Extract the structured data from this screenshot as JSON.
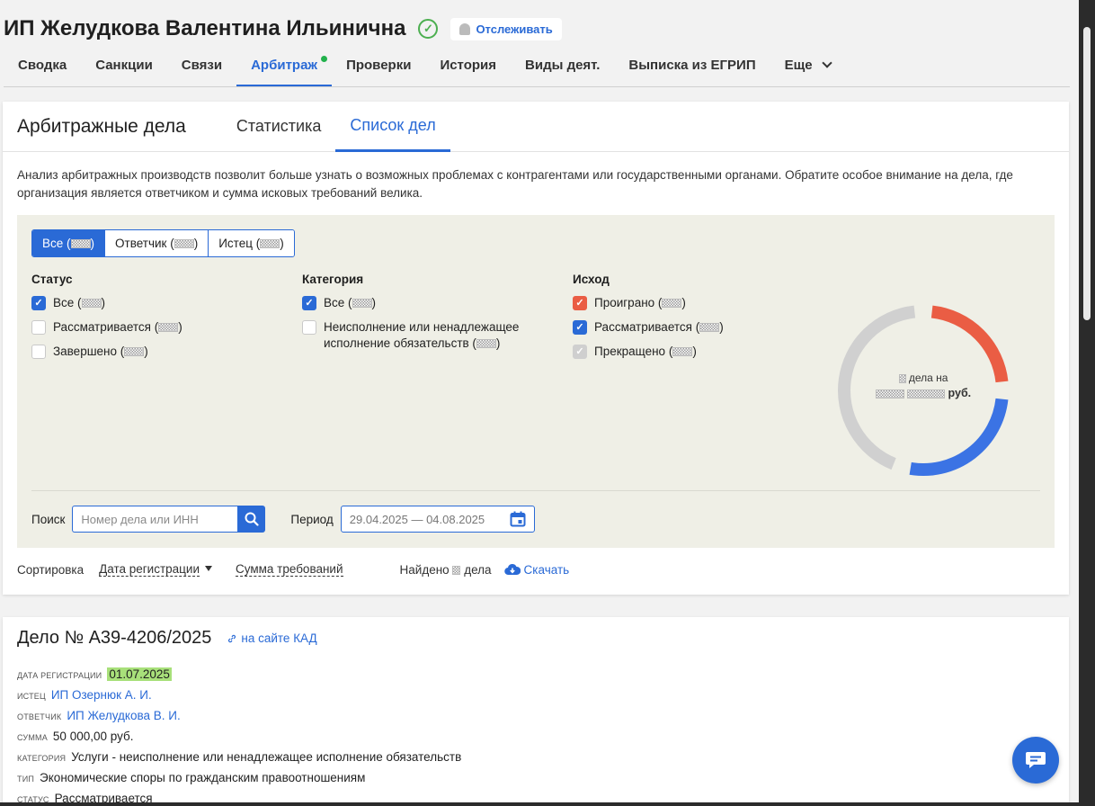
{
  "header": {
    "company_name": "ИП Желудкова Валентина Ильинична",
    "follow_label": "Отслеживать"
  },
  "nav": [
    {
      "label": "Сводка"
    },
    {
      "label": "Санкции"
    },
    {
      "label": "Связи"
    },
    {
      "label": "Арбитраж",
      "active": true
    },
    {
      "label": "Проверки"
    },
    {
      "label": "История"
    },
    {
      "label": "Виды деят."
    },
    {
      "label": "Выписка из ЕГРИП"
    },
    {
      "label": "Еще"
    }
  ],
  "arbitration": {
    "title": "Арбитражные дела",
    "tabs": [
      "Статистика",
      "Список дел"
    ],
    "active_tab": "Список дел",
    "description": "Анализ арбитражных производств позволит больше узнать о возможных проблемах с контрагентами или государственными органами. Обратите особое внимание на дела, где организация является ответчиком и сумма исковых требований велика.",
    "role_filter": {
      "all": "Все",
      "defendant": "Ответчик",
      "plaintiff": "Истец"
    },
    "status": {
      "title": "Статус",
      "items": [
        "Все",
        "Рассматривается",
        "Завершено"
      ]
    },
    "category": {
      "title": "Категория",
      "items": [
        "Все",
        "Неисполнение или ненадлежащее исполнение обязательств"
      ]
    },
    "outcome": {
      "title": "Исход",
      "items": [
        "Проиграно",
        "Рассматривается",
        "Прекращено"
      ]
    },
    "donut": {
      "line1": "дела на",
      "line2": "руб.",
      "segments": [
        {
          "name": "Проиграно",
          "color": "#ea5d44",
          "fraction": 0.23
        },
        {
          "name": "Рассматривается",
          "color": "#3b73e4",
          "fraction": 0.27
        },
        {
          "name": "Прекращено",
          "color": "#d0d0d0",
          "fraction": 0.42
        }
      ]
    },
    "search": {
      "label": "Поиск",
      "placeholder": "Номер дела или ИНН"
    },
    "period": {
      "label": "Период",
      "value": "29.04.2025 — 04.08.2025"
    },
    "sort": {
      "label": "Сортировка",
      "option1": "Дата регистрации",
      "option2": "Сумма требований"
    },
    "found": {
      "prefix": "Найдено",
      "suffix": "дела"
    },
    "download_label": "Скачать"
  },
  "case": {
    "title": "Дело № А39-4206/2025",
    "kad_link": "на сайте КАД",
    "fields": {
      "reg_date_label": "Дата регистрации",
      "reg_date": "01.07.2025",
      "plaintiff_label": "Истец",
      "plaintiff": "ИП Озернюк А. И.",
      "defendant_label": "Ответчик",
      "defendant": "ИП Желудкова В. И.",
      "sum_label": "Сумма",
      "sum": "50 000,00 руб.",
      "category_label": "Категория",
      "category": "Услуги - неисполнение или ненадлежащее исполнение обязательств",
      "type_label": "Тип",
      "type": "Экономические споры по гражданским правоотношениям",
      "status_label": "Статус",
      "status": "Рассматривается"
    }
  },
  "colors": {
    "accent": "#2a6ad6",
    "lost": "#ea5d44",
    "pending": "#3b73e4",
    "terminated": "#d0d0d0",
    "filter_bg": "#efefe6"
  }
}
